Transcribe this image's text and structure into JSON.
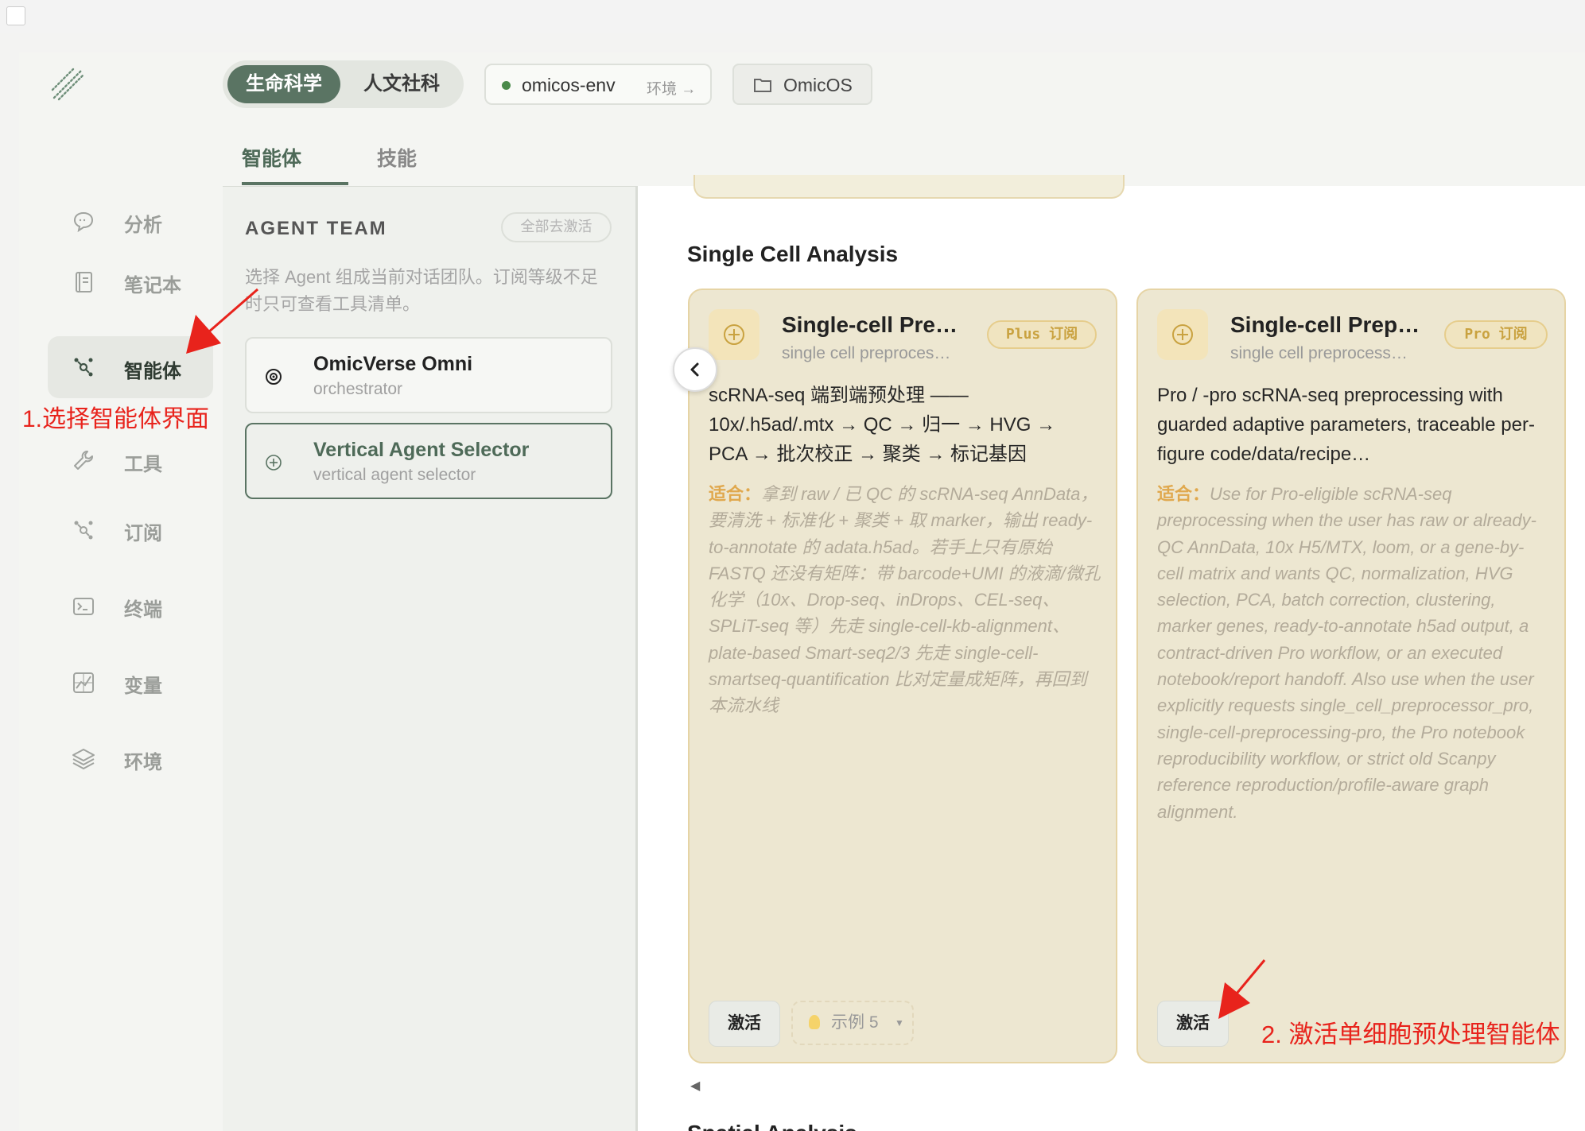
{
  "header": {
    "domain_tabs": [
      "生命科学",
      "人文社科"
    ],
    "active_domain": "生命科学",
    "env_name": "omicos-env",
    "env_suffix": "环境 →",
    "project_name": "OmicOS"
  },
  "sidebar": {
    "items": [
      {
        "label": "分析",
        "icon": "chat-bubble-icon"
      },
      {
        "label": "笔记本",
        "icon": "notebook-icon"
      },
      {
        "label": "智能体",
        "icon": "agent-network-icon",
        "active": true
      },
      {
        "label": "工具",
        "icon": "wrench-icon"
      },
      {
        "label": "订阅",
        "icon": "agent-network-icon"
      },
      {
        "label": "终端",
        "icon": "terminal-icon"
      },
      {
        "label": "变量",
        "icon": "variable-chart-icon"
      },
      {
        "label": "环境",
        "icon": "layers-icon"
      }
    ]
  },
  "tabs": {
    "agents": "智能体",
    "skills": "技能"
  },
  "agent_team": {
    "title": "AGENT TEAM",
    "deactivate_all": "全部去激活",
    "description": "选择 Agent 组成当前对话团队。订阅等级不足时只可查看工具清单。",
    "agents": [
      {
        "name": "OmicVerse Omni",
        "sub": "orchestrator",
        "icon": "target-icon"
      },
      {
        "name": "Vertical Agent Selector",
        "sub": "vertical agent selector",
        "icon": "plus-circle-icon",
        "selected": true
      }
    ]
  },
  "content": {
    "section_title": "Single Cell Analysis",
    "next_section_title": "Spatial Analysis",
    "cards": [
      {
        "title": "Single-cell Pre…",
        "subtitle": "single cell preproces…",
        "badge": "Plus 订阅",
        "description": "scRNA-seq 端到端预处理 —— 10x/.h5ad/.mtx → QC → 归一 → HVG → PCA → 批次校正 → 聚类 → 标记基因",
        "fit_label": "适合：",
        "fit_text": "拿到 raw / 已 QC 的 scRNA-seq AnnData，要清洗 + 标准化 + 聚类 + 取 marker，输出 ready-to-annotate 的 adata.h5ad。若手上只有原始 FASTQ 还没有矩阵：带 barcode+UMI 的液滴/微孔化学（10x、Drop-seq、inDrops、CEL-seq、SPLiT-seq 等）先走 single-cell-kb-alignment、plate-based Smart-seq2/3 先走 single-cell-smartseq-quantification 比对定量成矩阵，再回到本流水线",
        "activate": "激活",
        "example": "示例 5"
      },
      {
        "title": "Single-cell Prep…",
        "subtitle": "single cell preprocess…",
        "badge": "Pro 订阅",
        "description": "Pro / -pro scRNA-seq preprocessing with guarded adaptive parameters, traceable per-figure code/data/recipe…",
        "fit_label": "适合：",
        "fit_text": "Use for Pro-eligible scRNA-seq preprocessing when the user has raw or already-QC AnnData, 10x H5/MTX, loom, or a gene-by-cell matrix and wants QC, normalization, HVG selection, PCA, batch correction, clustering, marker genes, ready-to-annotate h5ad output, a contract-driven Pro workflow, or an executed notebook/report handoff. Also use when the user explicitly requests single_cell_preprocessor_pro, single-cell-preprocessing-pro, the Pro notebook reproducibility workflow, or strict old Scanpy reference reproduction/profile-aware graph alignment.",
        "activate": "激活"
      }
    ]
  },
  "annotations": {
    "step1": "1.选择智能体界面",
    "step2": "2. 激活单细胞预处理智能体"
  },
  "colors": {
    "brand_green": "#5a7463",
    "card_bg": "#ede7d1",
    "badge_gold": "#c9a240",
    "fit_label": "#e0a84d",
    "annotation_red": "#e8231c"
  }
}
